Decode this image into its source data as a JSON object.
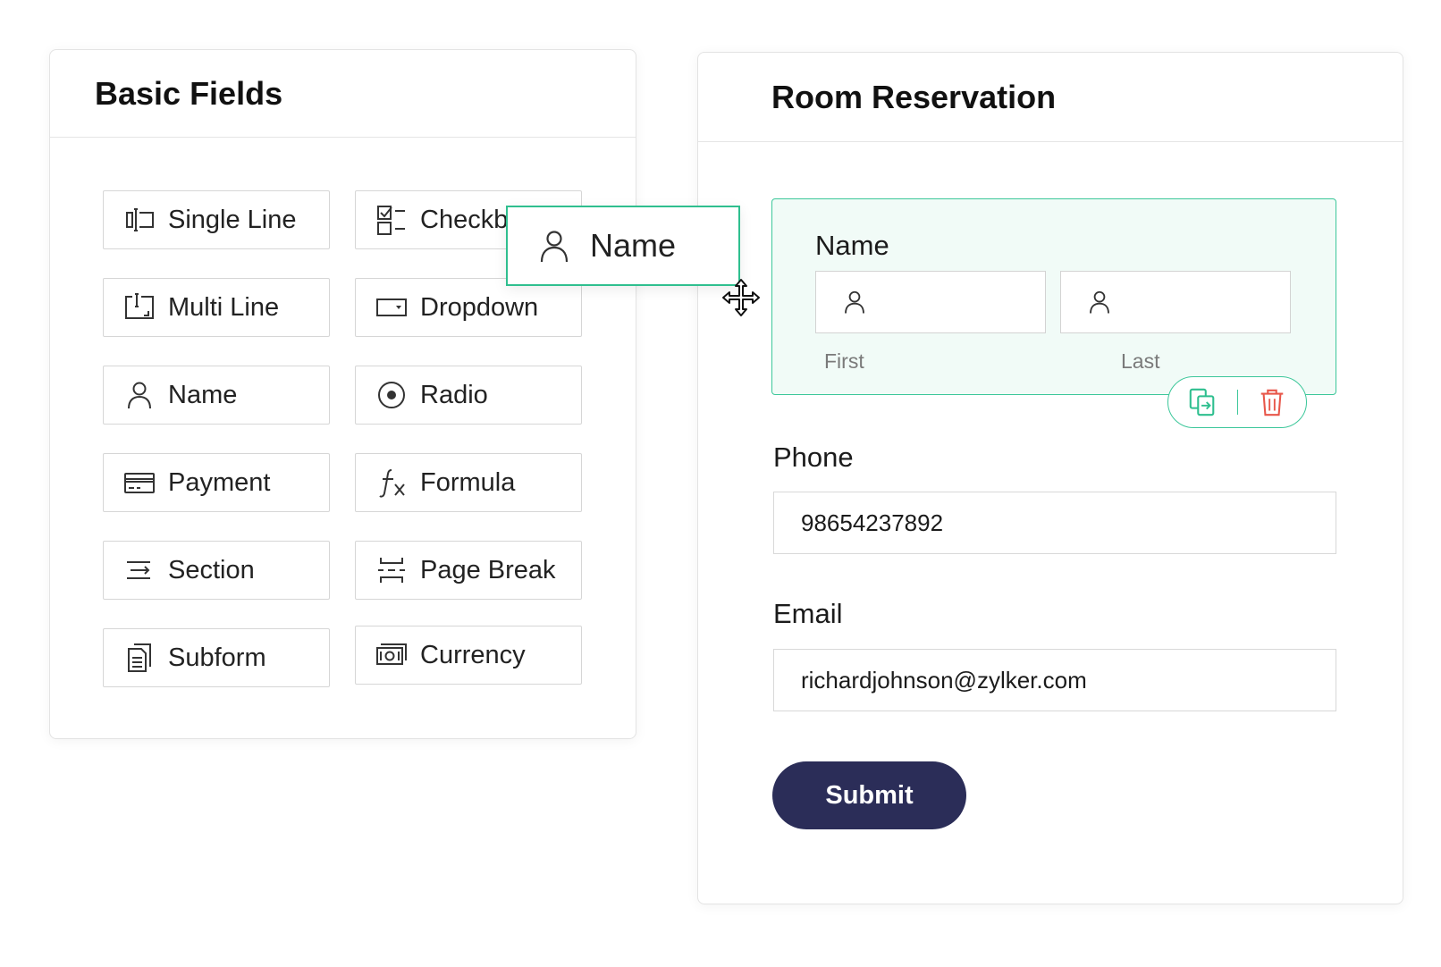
{
  "basic_fields": {
    "title": "Basic Fields",
    "items": [
      {
        "label": "Single Line",
        "icon": "single-line-icon"
      },
      {
        "label": "Checkbox",
        "icon": "checkbox-icon"
      },
      {
        "label": "Multi Line",
        "icon": "multi-line-icon"
      },
      {
        "label": "Dropdown",
        "icon": "dropdown-icon"
      },
      {
        "label": "Name",
        "icon": "person-icon"
      },
      {
        "label": "Radio",
        "icon": "radio-icon"
      },
      {
        "label": "Payment",
        "icon": "card-icon"
      },
      {
        "label": "Formula",
        "icon": "formula-icon"
      },
      {
        "label": "Section",
        "icon": "section-icon"
      },
      {
        "label": "Page Break",
        "icon": "page-break-icon"
      },
      {
        "label": "Subform",
        "icon": "subform-icon"
      },
      {
        "label": "Currency",
        "icon": "currency-icon"
      }
    ]
  },
  "drag_ghost": {
    "label": "Name",
    "icon": "person-icon"
  },
  "form": {
    "title": "Room Reservation",
    "name_field": {
      "label": "Name",
      "first_label": "First",
      "last_label": "Last",
      "first_value": "",
      "last_value": ""
    },
    "phone": {
      "label": "Phone",
      "value": "98654237892"
    },
    "email": {
      "label": "Email",
      "value": "richardjohnson@zylker.com"
    },
    "submit_label": "Submit"
  },
  "colors": {
    "accent_green": "#3cc79a",
    "submit_bg": "#2b2d58",
    "delete_red": "#e8574a"
  }
}
